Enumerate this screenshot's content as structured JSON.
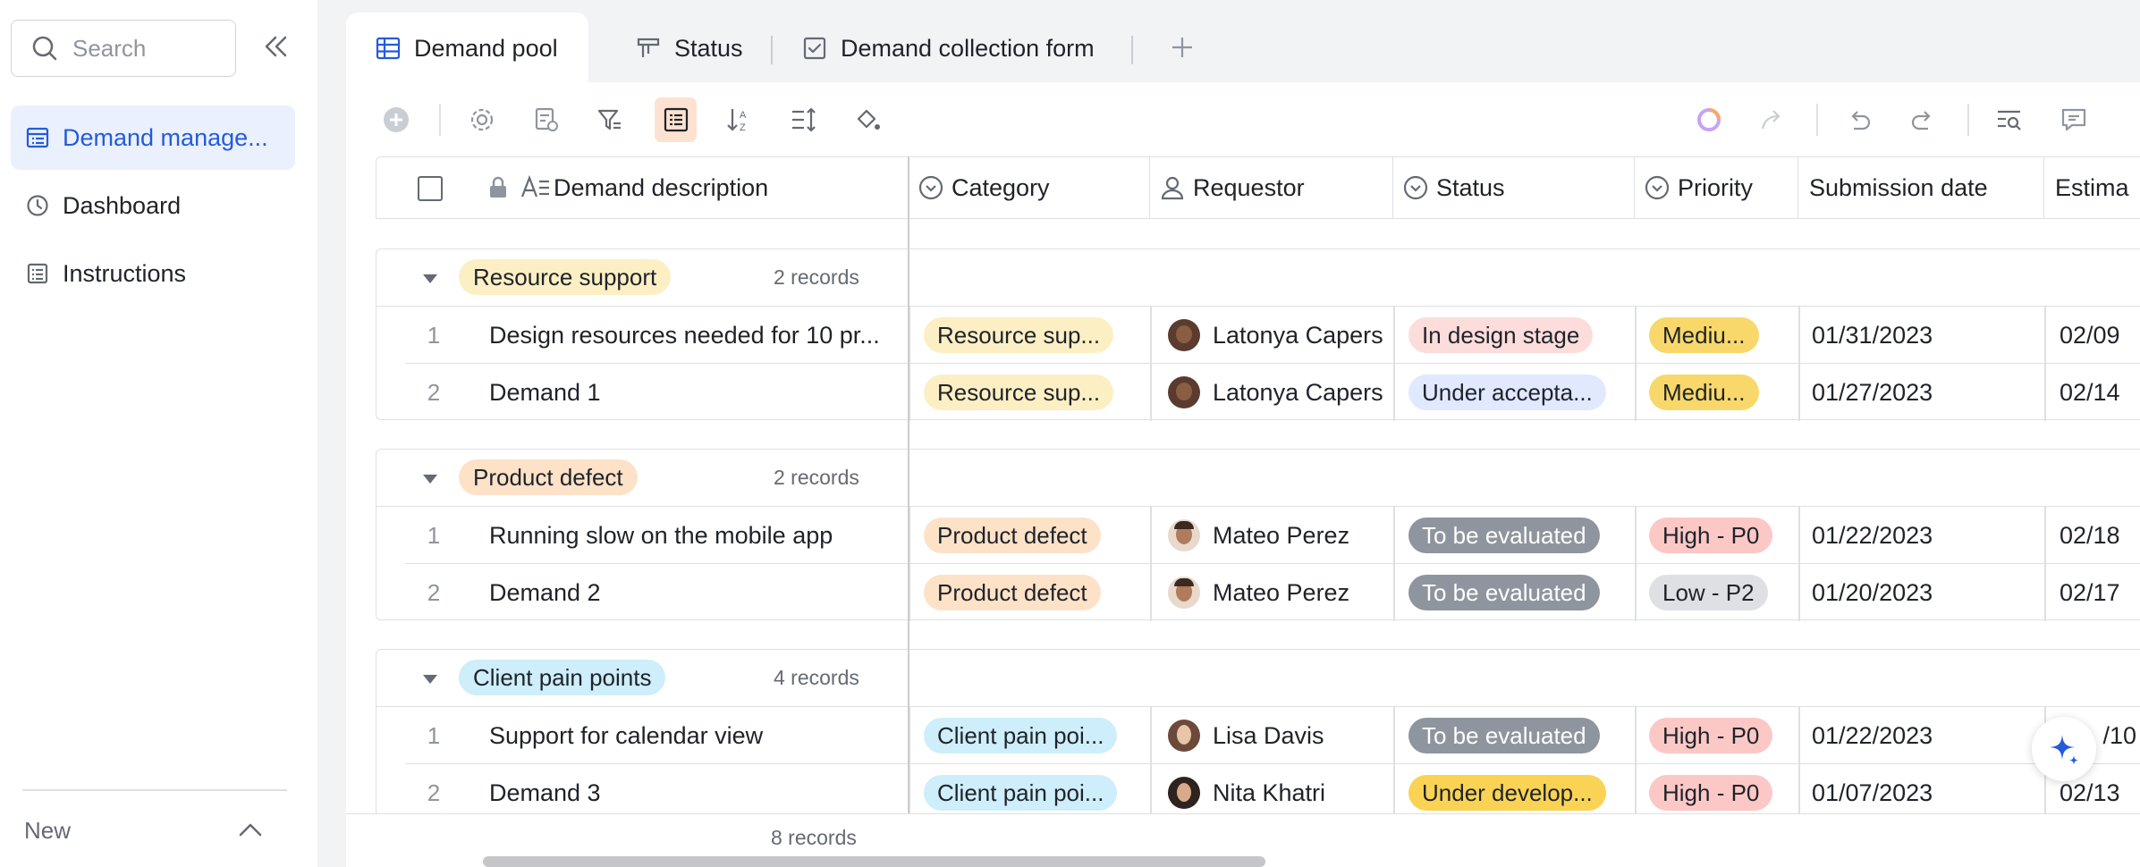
{
  "sidebar": {
    "search_placeholder": "Search",
    "items": [
      {
        "label": "Demand manage...",
        "icon": "table-icon",
        "active": true
      },
      {
        "label": "Dashboard",
        "icon": "dashboard-icon",
        "active": false
      },
      {
        "label": "Instructions",
        "icon": "doc-icon",
        "active": false
      }
    ],
    "new_label": "New"
  },
  "tabs": [
    {
      "label": "Demand pool",
      "icon": "grid-view-icon",
      "active": true
    },
    {
      "label": "Status",
      "icon": "kanban-icon",
      "active": false
    },
    {
      "label": "Demand collection form",
      "icon": "form-icon",
      "active": false
    }
  ],
  "columns": {
    "description": "Demand description",
    "category": "Category",
    "requestor": "Requestor",
    "status": "Status",
    "priority": "Priority",
    "submission": "Submission date",
    "estimated": "Estima"
  },
  "groups": [
    {
      "name": "Resource support",
      "count": "2 records",
      "rows": [
        {
          "num": "1",
          "desc": "Design resources needed for 10 pr...",
          "category": "Resource sup...",
          "requestor": "Latonya Capers",
          "status": "In design stage",
          "priority": "Mediu...",
          "submission": "01/31/2023",
          "estimated": "02/09"
        },
        {
          "num": "2",
          "desc": "Demand 1",
          "category": "Resource sup...",
          "requestor": "Latonya Capers",
          "status": "Under accepta...",
          "priority": "Mediu...",
          "submission": "01/27/2023",
          "estimated": "02/14"
        }
      ]
    },
    {
      "name": "Product defect",
      "count": "2 records",
      "rows": [
        {
          "num": "1",
          "desc": "Running slow on the mobile app",
          "category": "Product defect",
          "requestor": "Mateo Perez",
          "status": "To be evaluated",
          "priority": "High - P0",
          "submission": "01/22/2023",
          "estimated": "02/18"
        },
        {
          "num": "2",
          "desc": "Demand 2",
          "category": "Product defect",
          "requestor": "Mateo Perez",
          "status": "To be evaluated",
          "priority": "Low - P2",
          "submission": "01/20/2023",
          "estimated": "02/17"
        }
      ]
    },
    {
      "name": "Client pain points",
      "count": "4 records",
      "rows": [
        {
          "num": "1",
          "desc": "Support for calendar view",
          "category": "Client pain poi...",
          "requestor": "Lisa Davis",
          "status": "To be evaluated",
          "priority": "High - P0",
          "submission": "01/22/2023",
          "estimated": "/10"
        },
        {
          "num": "2",
          "desc": "Demand 3",
          "category": "Client pain poi...",
          "requestor": "Nita Khatri",
          "status": "Under develop...",
          "priority": "High - P0",
          "submission": "01/07/2023",
          "estimated": "02/13"
        }
      ]
    }
  ],
  "footer": {
    "count": "8 records"
  },
  "colors": {
    "accent": "#245bdb",
    "resource_tag": "#fcefc4",
    "defect_tag": "#fde2c8",
    "client_tag": "#cdeefa",
    "status_design": "#fddddb",
    "status_accept": "#e0e9ff",
    "status_eval": "#8f959e",
    "status_dev": "#fad355",
    "priority_medium": "#f8d86a",
    "priority_high": "#fcc8c6",
    "priority_low": "#dee0e3"
  }
}
